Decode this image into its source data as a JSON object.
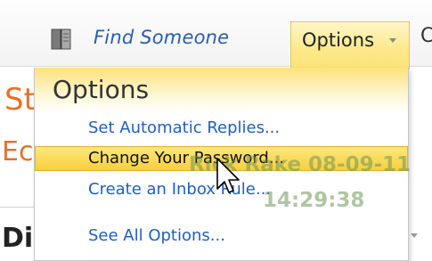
{
  "toolbar": {
    "find_someone_label": "Find Someone",
    "book_icon": "address-book-icon",
    "options_tab_label": "Options",
    "partial_next_label": "C"
  },
  "background": {
    "orange_text_1": "St",
    "orange_text_2": "Ec",
    "heading_partial": "Di"
  },
  "menu": {
    "title": "Options",
    "items": [
      {
        "label": "Set Automatic Replies..."
      },
      {
        "label": "Change Your Password..."
      },
      {
        "label": "Create an Inbox Rule..."
      },
      {
        "label": "See All Options..."
      }
    ],
    "highlighted_index": 1
  },
  "watermark": {
    "line1": "Rick Rake 08-09-11",
    "line2": "14:29:38"
  },
  "colors": {
    "accent_yellow": "#f9cf3b",
    "link_blue": "#1f5fbf",
    "brand_orange": "#e8702a"
  }
}
